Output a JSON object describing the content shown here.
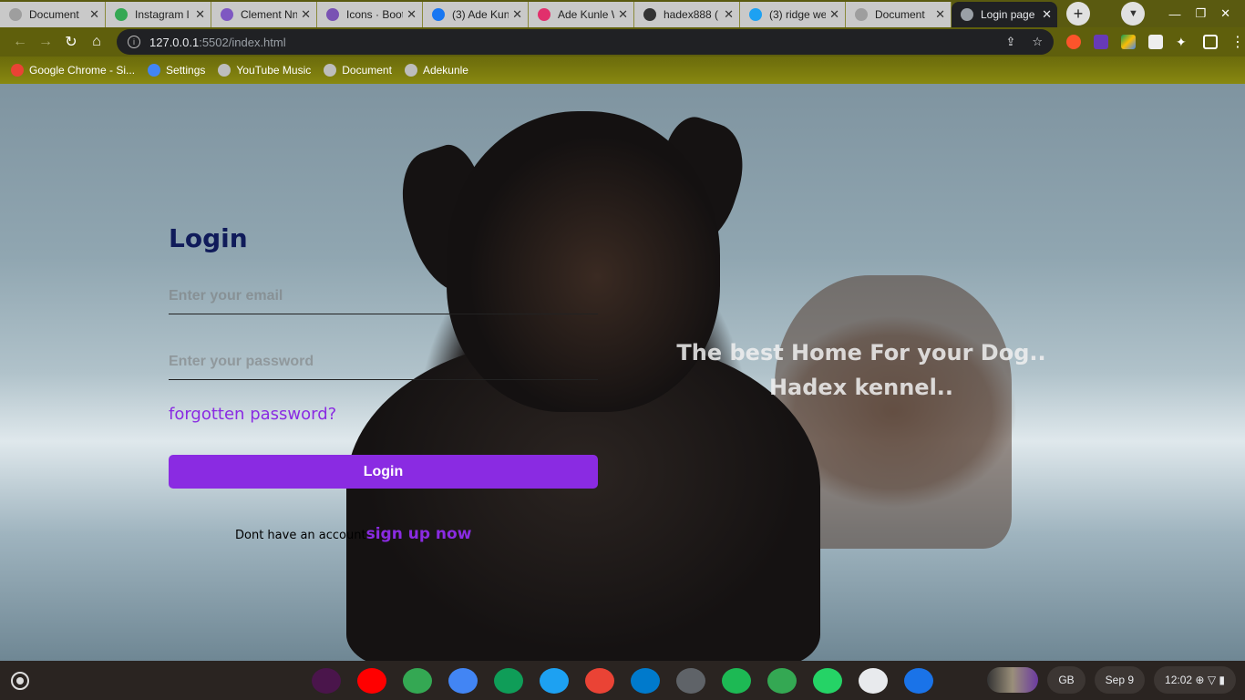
{
  "browser": {
    "tabs": [
      {
        "title": "Document",
        "favicon_color": "#9e9e9e"
      },
      {
        "title": "Instagram l",
        "favicon_color": "#34a853"
      },
      {
        "title": "Clement Nn",
        "favicon_color": "#7e57c2"
      },
      {
        "title": "Icons · Boot",
        "favicon_color": "#7952b3"
      },
      {
        "title": "(3) Ade Kun",
        "favicon_color": "#1877f2"
      },
      {
        "title": "Ade Kunle W",
        "favicon_color": "#e1306c"
      },
      {
        "title": "hadex888 (",
        "favicon_color": "#333333"
      },
      {
        "title": "(3) ridge we",
        "favicon_color": "#1da1f2"
      },
      {
        "title": "Document",
        "favicon_color": "#9e9e9e"
      },
      {
        "title": "Login page",
        "favicon_color": "#9aa0a6",
        "active": true
      }
    ],
    "new_tab_label": "+",
    "url_host": "127.0.0.1",
    "url_path": ":5502/index.html",
    "bookmarks": [
      {
        "label": "Google Chrome - Si...",
        "icon_color": "#ea4335"
      },
      {
        "label": "Settings",
        "icon_color": "#4285f4"
      },
      {
        "label": "YouTube Music",
        "icon_color": "#bdbdbd"
      },
      {
        "label": "Document",
        "icon_color": "#bdbdbd"
      },
      {
        "label": "Adekunle",
        "icon_color": "#bdbdbd"
      }
    ]
  },
  "login": {
    "title": "Login",
    "email_placeholder": "Enter your email",
    "password_placeholder": "Enter your password",
    "forgot_label": "forgotten password?",
    "button_label": "Login",
    "signup_prompt": "Dont have an account",
    "signup_link": "sign up now"
  },
  "hero": {
    "line1": "The best Home For your Dog..",
    "line2": "Hadex kennel.."
  },
  "shelf": {
    "apps": [
      {
        "name": "slack",
        "color": "#4a154b"
      },
      {
        "name": "youtube",
        "color": "#ff0000"
      },
      {
        "name": "chrome",
        "color": "#34a853"
      },
      {
        "name": "docs",
        "color": "#4285f4"
      },
      {
        "name": "sheets",
        "color": "#0f9d58"
      },
      {
        "name": "twitter",
        "color": "#1da1f2"
      },
      {
        "name": "gmail",
        "color": "#ea4335"
      },
      {
        "name": "vscode",
        "color": "#007acc"
      },
      {
        "name": "settings",
        "color": "#5f6368"
      },
      {
        "name": "spotify",
        "color": "#1db954"
      },
      {
        "name": "maps",
        "color": "#34a853"
      },
      {
        "name": "whatsapp",
        "color": "#25d366"
      },
      {
        "name": "terminal",
        "color": "#e8eaed"
      },
      {
        "name": "files",
        "color": "#1a73e8"
      }
    ],
    "keyboard": "GB",
    "date": "Sep 9",
    "time": "12:02"
  }
}
